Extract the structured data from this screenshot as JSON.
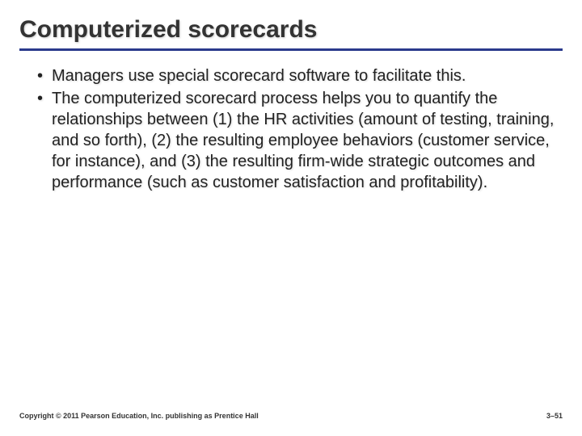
{
  "slide": {
    "title": "Computerized scorecards",
    "bullets": [
      "Managers use special scorecard software to facilitate this.",
      "The computerized scorecard process helps you to quantify the relationships between (1) the HR activities (amount of testing, training, and so forth), (2) the resulting employee behaviors (customer service, for instance), and (3) the resulting firm-wide strategic outcomes and performance (such as customer satisfaction and profitability)."
    ]
  },
  "footer": {
    "copyright": "Copyright © 2011 Pearson Education, Inc. publishing as Prentice Hall",
    "page": "3–51"
  }
}
